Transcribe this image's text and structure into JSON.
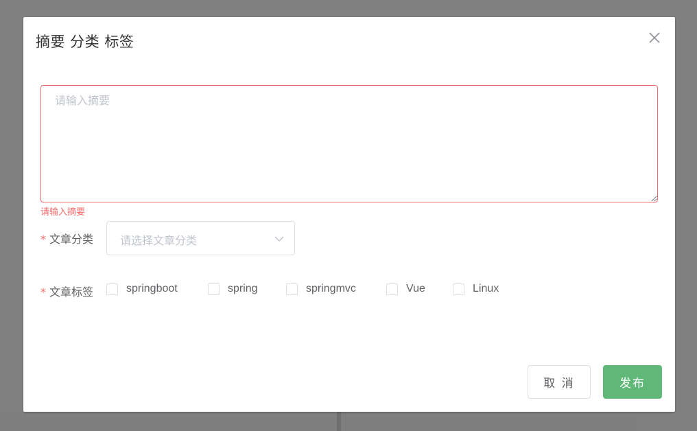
{
  "dialog": {
    "title": "摘要 分类 标签",
    "close_icon": "close-icon"
  },
  "summary": {
    "placeholder": "请输入摘要",
    "value": "",
    "error": "请输入摘要"
  },
  "category": {
    "required_mark": "*",
    "label": "文章分类",
    "placeholder": "请选择文章分类",
    "arrow_icon": "chevron-down-icon"
  },
  "tags": {
    "required_mark": "*",
    "label": "文章标签",
    "options": [
      {
        "label": "springboot",
        "checked": false
      },
      {
        "label": "spring",
        "checked": false
      },
      {
        "label": "springmvc",
        "checked": false
      },
      {
        "label": "Vue",
        "checked": false
      },
      {
        "label": "Linux",
        "checked": false
      }
    ]
  },
  "buttons": {
    "cancel": "取 消",
    "publish": "发布"
  },
  "colors": {
    "overlay": "#808080",
    "error": "#f56c6c",
    "primary": "#5fb878",
    "text": "#606266",
    "placeholder": "#c0c4cc",
    "border": "#dcdfe6"
  }
}
